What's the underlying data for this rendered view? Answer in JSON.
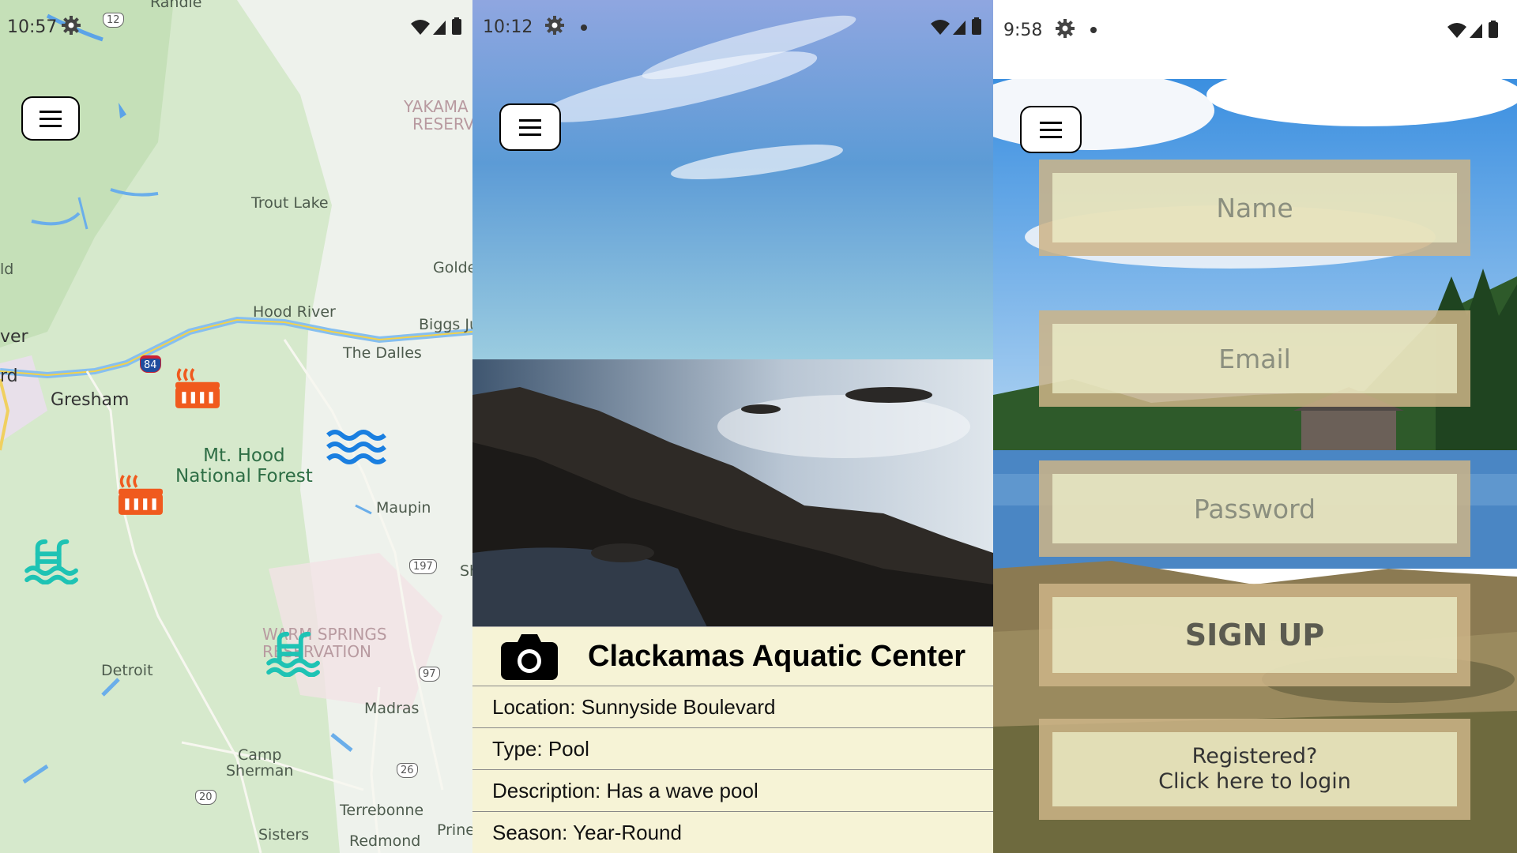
{
  "panel_map": {
    "status": {
      "time": "10:57"
    },
    "labels": {
      "randle": "Randle",
      "trout_lake": "Trout Lake",
      "yakama": "YAKAMA I",
      "reservation": "RESERVA",
      "ld": "ld",
      "golden": "Golde",
      "hood_river": "Hood River",
      "biggs": "Biggs Ju",
      "ver": "ver",
      "the_dalles": "The Dalles",
      "rd": "rd",
      "gresham": "Gresham",
      "mt_hood_1": "Mt. Hood",
      "mt_hood_2": "National Forest",
      "maupin": "Maupin",
      "warm_springs_1": "WARM SPRINGS",
      "warm_springs_2": "RESERVATION",
      "sh": "Sh",
      "detroit": "Detroit",
      "madras": "Madras",
      "camp_1": "Camp",
      "camp_2": "Sherman",
      "terrebonne": "Terrebonne",
      "sisters": "Sisters",
      "redmond": "Redmond",
      "prineville": "Prine"
    },
    "shields": {
      "r12": "12",
      "r84": "84",
      "r197": "197",
      "r97": "97",
      "r26": "26",
      "r20": "20"
    },
    "colors": {
      "hot_spring": "#f05a1e",
      "pool": "#1ec3b4",
      "river": "#1a7fe0"
    }
  },
  "panel_details": {
    "status": {
      "time": "10:12"
    },
    "title": "Clackamas Aquatic Center",
    "rows": [
      "Location: Sunnyside Boulevard",
      "Type: Pool",
      "Description: Has a wave pool",
      "Season: Year-Round"
    ]
  },
  "panel_signup": {
    "status": {
      "time": "9:58"
    },
    "name_placeholder": "Name",
    "email_placeholder": "Email",
    "password_placeholder": "Password",
    "signup_label": "SIGN UP",
    "login_line1": "Registered?",
    "login_line2": "Click here to login"
  }
}
